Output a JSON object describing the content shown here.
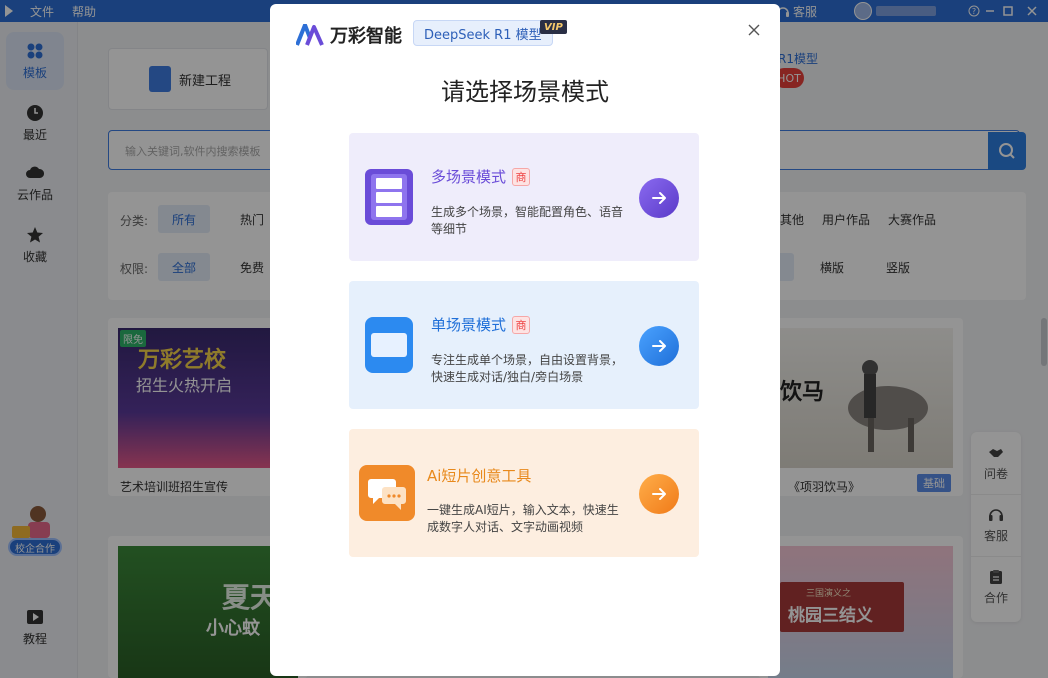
{
  "titlebar": {
    "file": "文件",
    "help": "帮助",
    "service": "客服"
  },
  "sidebar": {
    "items": [
      {
        "label": "模板"
      },
      {
        "label": "最近"
      },
      {
        "label": "云作品"
      },
      {
        "label": "收藏"
      },
      {
        "label": "教程"
      }
    ],
    "promo": "校企合作"
  },
  "main": {
    "new_project": "新建工程",
    "search_placeholder": "输入关键词,软件内搜索模板",
    "filters": {
      "category_label": "分类:",
      "category_chips": [
        "所有",
        "热门",
        "其他",
        "用户作品",
        "大赛作品"
      ],
      "permission_label": "权限:",
      "permission_chips": [
        "全部",
        "免费",
        "横版",
        "竖版"
      ]
    },
    "templates": [
      {
        "name": "艺术培训班招生宣传",
        "limited": "限免",
        "title": "万彩艺校",
        "subtitle": "招生火热开启"
      },
      {
        "name": "《项羽饮马》",
        "big": "饮马",
        "tag": "基础"
      },
      {
        "title": "夏天",
        "subtitle": "小心蚊"
      },
      {
        "small": "三国演义之",
        "title": "桃园三结义"
      }
    ],
    "partial_model": "R1模型",
    "partial_hot": "HOT"
  },
  "right_tools": [
    {
      "label": "问卷"
    },
    {
      "label": "客服"
    },
    {
      "label": "合作"
    }
  ],
  "modal": {
    "brand": "万彩智能",
    "model": "DeepSeek R1 模型",
    "vip": "VIP",
    "title": "请选择场景模式",
    "options": [
      {
        "title": "多场景模式",
        "badge": "商",
        "desc": "生成多个场景，智能配置角色、语音等细节",
        "color": "#6a4cd8"
      },
      {
        "title": "单场景模式",
        "badge": "商",
        "desc": "专注生成单个场景，自由设置背景，快速生成对话/独白/旁白场景",
        "color": "#1f6fd8"
      },
      {
        "title": "Ai短片创意工具",
        "desc": "一键生成AI短片，输入文本，快速生成数字人对话、文字动画视频",
        "color": "#e8891c"
      }
    ]
  }
}
